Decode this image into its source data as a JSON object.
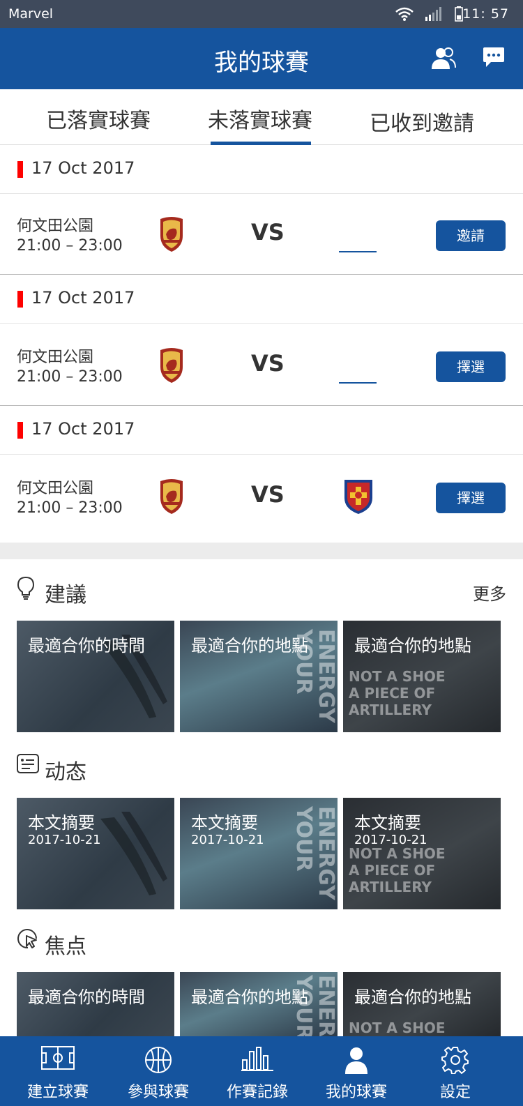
{
  "status_bar": {
    "carrier": "Marvel",
    "time": "11: 57"
  },
  "header": {
    "title": "我的球賽"
  },
  "tabs": [
    {
      "label": "已落實球賽"
    },
    {
      "label": "未落實球賽",
      "active": true
    },
    {
      "label": "已收到邀請"
    }
  ],
  "matches": [
    {
      "date": "17 Oct 2017",
      "venue": "何文田公園",
      "time": "21:00 – 23:00",
      "vs": "VS",
      "button": "邀請",
      "has_away_logo": false
    },
    {
      "date": "17 Oct 2017",
      "venue": "何文田公園",
      "time": "21:00 – 23:00",
      "vs": "VS",
      "button": "擇選",
      "has_away_logo": false
    },
    {
      "date": "17 Oct 2017",
      "venue": "何文田公園",
      "time": "21:00 – 23:00",
      "vs": "VS",
      "button": "擇選",
      "has_away_logo": true
    }
  ],
  "suggestions": {
    "label": "建議",
    "more": "更多",
    "cards": [
      {
        "text": "最適合你的時間"
      },
      {
        "text": "最適合你的地點"
      },
      {
        "text": "最適合你的地點"
      }
    ]
  },
  "news": {
    "label": "动态",
    "cards": [
      {
        "text": "本文摘要",
        "date": "2017-10-21"
      },
      {
        "text": "本文摘要",
        "date": "2017-10-21"
      },
      {
        "text": "本文摘要",
        "date": "2017-10-21"
      }
    ]
  },
  "focus": {
    "label": "焦点",
    "cards": [
      {
        "text": "最適合你的時間"
      },
      {
        "text": "最適合你的地點"
      },
      {
        "text": "最適合你的地點"
      }
    ]
  },
  "card_overlays": {
    "energy_a": "YOUR",
    "energy_b": "ENERGY",
    "shoe_a": "NOT A SHOE",
    "shoe_b": "A PIECE OF ARTILLERY"
  },
  "tabbar": [
    {
      "label": "建立球賽",
      "icon": "field-icon"
    },
    {
      "label": "參與球賽",
      "icon": "ball-icon"
    },
    {
      "label": "作賽記錄",
      "icon": "stats-icon"
    },
    {
      "label": "我的球賽",
      "icon": "person-icon",
      "active": true
    },
    {
      "label": "設定",
      "icon": "gear-icon"
    }
  ],
  "colors": {
    "primary": "#15549e",
    "accent_red": "#fe0100",
    "separator": "#ececec"
  }
}
